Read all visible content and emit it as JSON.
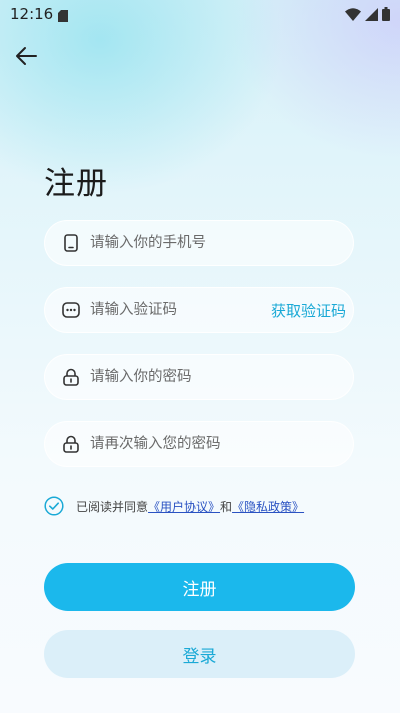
{
  "status_bar": {
    "time": "12:16"
  },
  "header": {
    "title": "注册"
  },
  "form": {
    "phone": {
      "value": "",
      "placeholder": "请输入你的手机号"
    },
    "code": {
      "value": "",
      "placeholder": "请输入验证码",
      "get_code_label": "获取验证码"
    },
    "password": {
      "value": "",
      "placeholder": "请输入你的密码"
    },
    "confirm_password": {
      "value": "",
      "placeholder": "请再次输入您的密码"
    }
  },
  "agreement": {
    "checked": true,
    "prefix": "已阅读并同意",
    "user_agreement": "《用户协议》",
    "connector": "和",
    "privacy_policy": "《隐私政策》"
  },
  "buttons": {
    "register": "注册",
    "login": "登录"
  },
  "colors": {
    "accent": "#1bb8ec",
    "link": "#2a52c2",
    "secondary_bg": "#dbeff9"
  },
  "icons": [
    "back-arrow-icon",
    "phone-icon",
    "message-icon",
    "lock-icon",
    "lock-icon",
    "check-circle-icon",
    "wifi-icon",
    "signal-icon",
    "battery-icon",
    "sim-icon"
  ]
}
